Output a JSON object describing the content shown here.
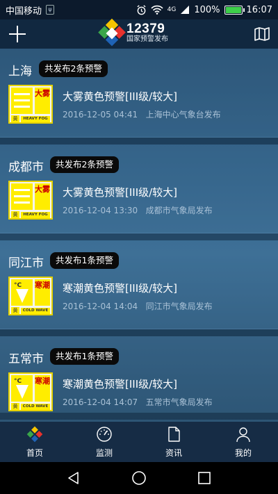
{
  "status_bar": {
    "carrier": "中国移动",
    "usb_icon": "usb-icon",
    "network": "4G",
    "battery_text": "100%",
    "battery_level": 1.0,
    "time": "16:07"
  },
  "header": {
    "logo_number": "12379",
    "logo_subtitle": "国家预警发布",
    "add_icon": "plus-icon",
    "map_icon": "map-icon"
  },
  "alerts": [
    {
      "city": "上海",
      "badge": "共发布2条预警",
      "icon_type": "heavy-fog",
      "icon_cn": "大雾",
      "icon_level": "黄",
      "icon_en": "HEAVY FOG",
      "title": "大雾黄色预警[III级/较大]",
      "time": "2016-12-05 04:41",
      "publisher": "上海中心气象台发布"
    },
    {
      "city": "成都市",
      "badge": "共发布2条预警",
      "icon_type": "heavy-fog",
      "icon_cn": "大雾",
      "icon_level": "黄",
      "icon_en": "HEAVY FOG",
      "title": "大雾黄色预警[III级/较大]",
      "time": "2016-12-04 13:30",
      "publisher": "成都市气象局发布"
    },
    {
      "city": "同江市",
      "badge": "共发布1条预警",
      "icon_type": "cold-wave",
      "icon_cn": "寒潮",
      "icon_level": "黄",
      "icon_en": "COLD WAVE",
      "title": "寒潮黄色预警[III级/较大]",
      "time": "2016-12-04 14:04",
      "publisher": "同江市气象局发布"
    },
    {
      "city": "五常市",
      "badge": "共发布1条预警",
      "icon_type": "cold-wave",
      "icon_cn": "寒潮",
      "icon_level": "黄",
      "icon_en": "COLD WAVE",
      "title": "寒潮黄色预警[III级/较大]",
      "time": "2016-12-04 14:07",
      "publisher": "五常市气象局发布"
    }
  ],
  "bottom_nav": [
    {
      "label": "首页",
      "icon": "home-icon"
    },
    {
      "label": "监测",
      "icon": "gauge-icon"
    },
    {
      "label": "资讯",
      "icon": "document-icon"
    },
    {
      "label": "我的",
      "icon": "person-icon"
    }
  ],
  "colors": {
    "warning_yellow": "#ffed00",
    "logo_red": "#e8322d",
    "logo_blue": "#1f63b6",
    "logo_yellow": "#f6c400",
    "logo_green": "#3aa64a"
  }
}
